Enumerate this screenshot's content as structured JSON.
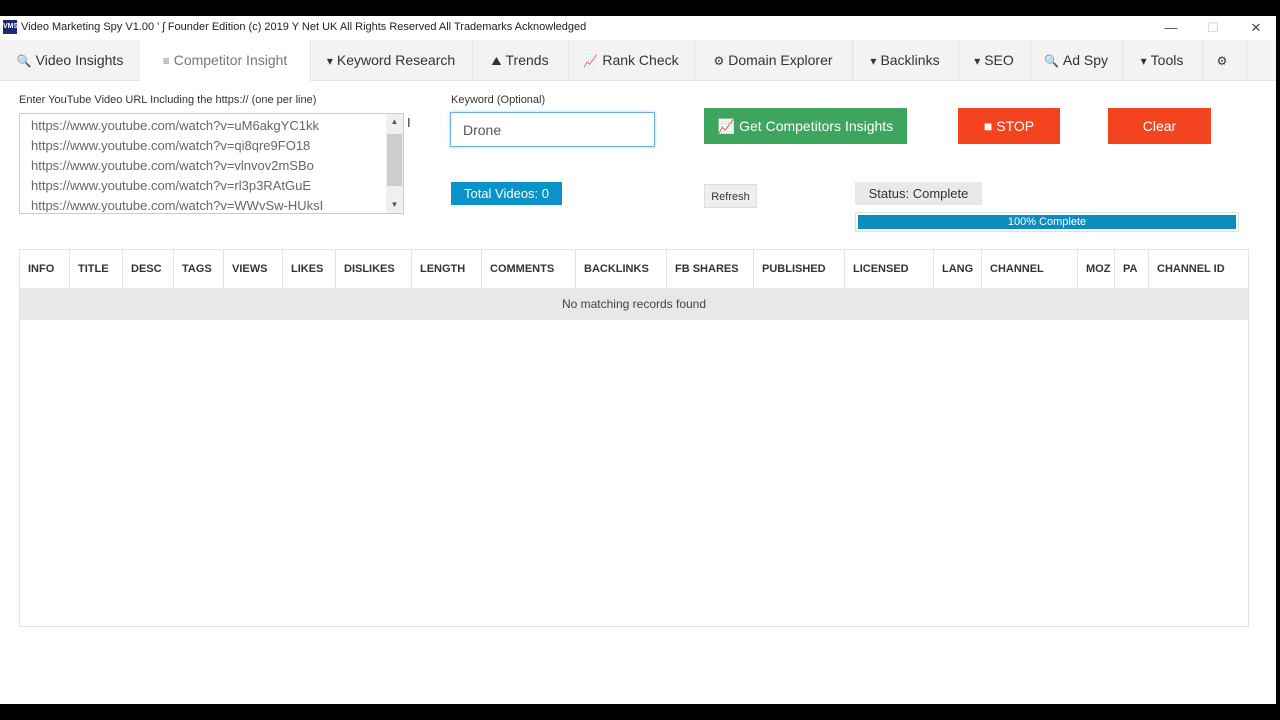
{
  "window": {
    "icon_text": "VMS",
    "title": "Video Marketing Spy V1.00   ' ʃ   Founder Edition (c) 2019 Y Net UK   All Rights Reserved   All Trademarks Acknowledged",
    "controls": [
      "—",
      "☐",
      "✕"
    ]
  },
  "tabs": [
    {
      "icon": "🔍",
      "label": "Video Insights"
    },
    {
      "icon": "≡",
      "label": "Competitor Insight"
    },
    {
      "icon": "▾",
      "label": "Keyword Research"
    },
    {
      "icon": "⛰",
      "label": "Trends"
    },
    {
      "icon": "📈",
      "label": "Rank Check"
    },
    {
      "icon": "⚙",
      "label": "Domain Explorer"
    },
    {
      "icon": "▾",
      "label": "Backlinks"
    },
    {
      "icon": "▾",
      "label": "SEO"
    },
    {
      "icon": "🔍",
      "label": "Ad Spy"
    },
    {
      "icon": "▾",
      "label": "Tools"
    },
    {
      "icon": "⚙",
      "label": ""
    }
  ],
  "form": {
    "url_label": "Enter YouTube Video URL Including the https:// (one per line)",
    "urls": [
      "https://www.youtube.com/watch?v=uM6akgYC1kk",
      "https://www.youtube.com/watch?v=qi8qre9FO18",
      "https://www.youtube.com/watch?v=vlnvov2mSBo",
      "https://www.youtube.com/watch?v=rl3p3RAtGuE",
      "https://www.youtube.com/watch?v=WWvSw-HUksI"
    ],
    "keyword_label": "Keyword (Optional)",
    "keyword_value": "Drone",
    "get_insights_label": "Get Competitors Insights",
    "stop_label": "STOP",
    "clear_label": "Clear",
    "total_videos": "Total Videos: 0",
    "refresh_label": "Refresh",
    "status": "Status: Complete",
    "progress_percent": 100,
    "progress_text": "100% Complete"
  },
  "table": {
    "columns": [
      "INFO",
      "TITLE",
      "DESC",
      "TAGS",
      "VIEWS",
      "LIKES",
      "DISLIKES",
      "LENGTH",
      "COMMENTS",
      "BACKLINKS",
      "FB SHARES",
      "PUBLISHED",
      "LICENSED",
      "LANG",
      "CHANNEL",
      "MOZ",
      "PA",
      "CHANNEL ID"
    ],
    "empty_message": "No matching records found"
  },
  "colors": {
    "green": "#3ea55f",
    "red": "#f3431f",
    "blue": "#0b92c9"
  }
}
